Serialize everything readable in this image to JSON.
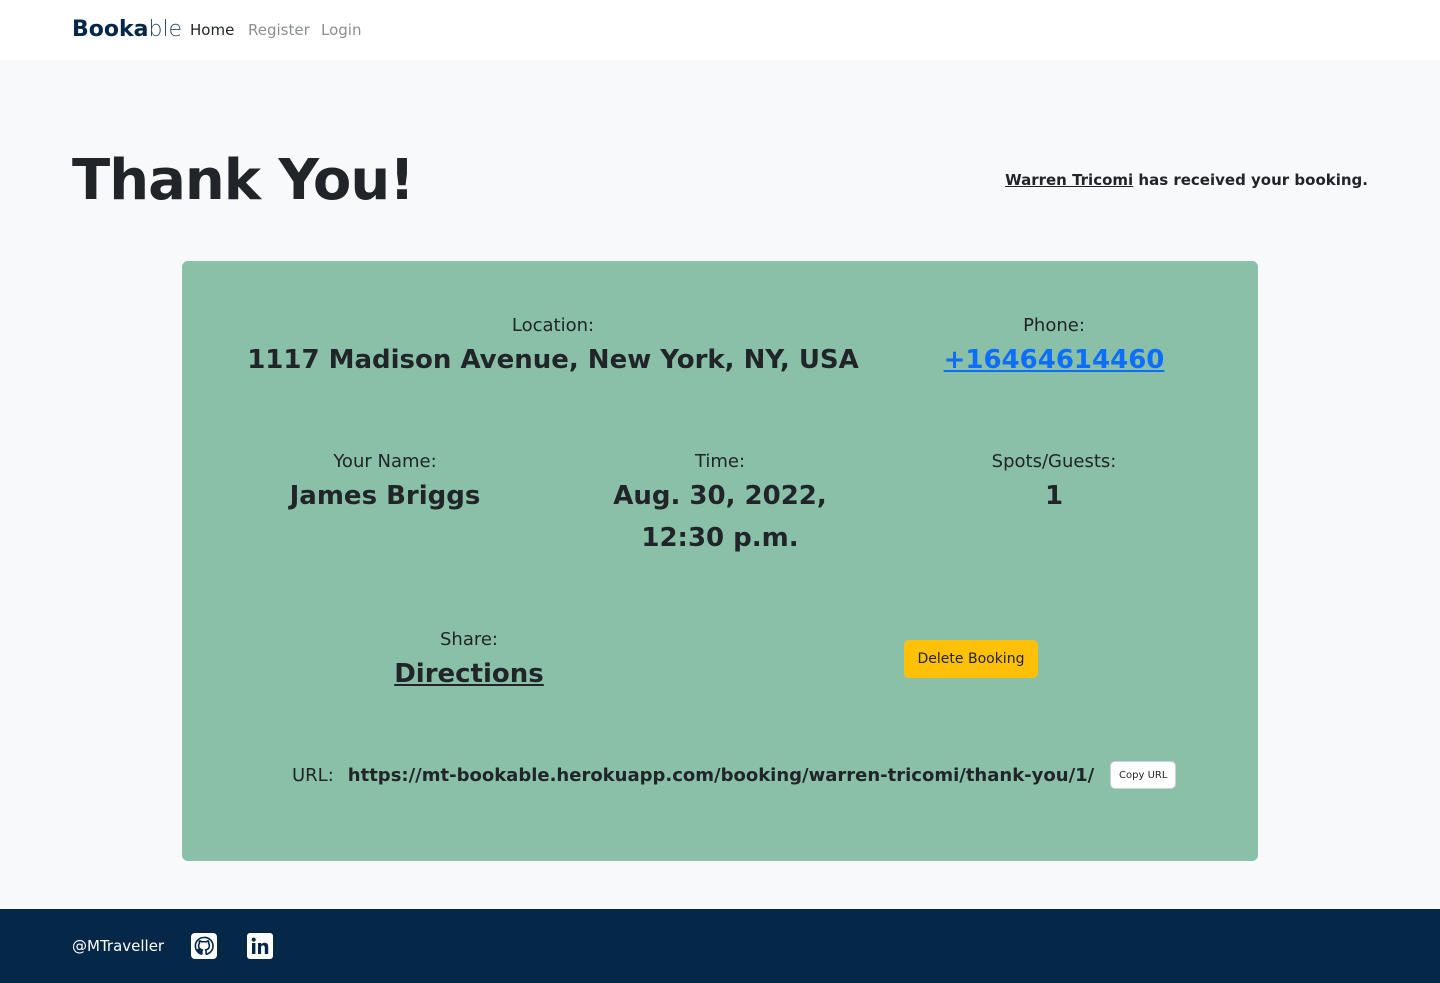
{
  "brand": {
    "bold": "Booka",
    "light": "ble"
  },
  "nav": {
    "home": "Home",
    "register": "Register",
    "login": "Login"
  },
  "page": {
    "title": "Thank You!",
    "host_name": "Warren Tricomi",
    "received_text": " has received your booking."
  },
  "booking": {
    "location_label": "Location:",
    "location_value": "1117 Madison Avenue, New York, NY, USA",
    "phone_label": "Phone:",
    "phone_value": "+16464614460",
    "name_label": "Your Name:",
    "name_value": "James Briggs",
    "time_label": "Time:",
    "time_value": "Aug. 30, 2022, 12:30 p.m.",
    "spots_label": "Spots/Guests:",
    "spots_value": "1",
    "share_label": "Share:",
    "share_link": "Directions",
    "delete_button": "Delete Booking",
    "url_label": "URL:",
    "url_value": "https://mt-bookable.herokuapp.com/booking/warren-tricomi/thank-you/1/",
    "copy_button": "Copy URL"
  },
  "footer": {
    "handle": "@MTraveller",
    "icons": [
      "github-icon",
      "linkedin-icon"
    ]
  },
  "colors": {
    "card_bg": "#89c0a7",
    "footer_bg": "#052849",
    "delete_button": "#ffc107",
    "link": "#0d6efd",
    "page_bg": "#f8f9fa"
  }
}
